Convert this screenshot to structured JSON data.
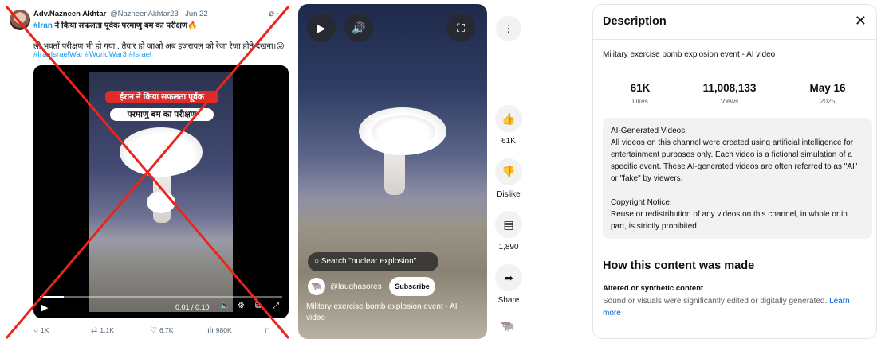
{
  "tweet": {
    "author_name": "Adv.Nazneen Akhtar",
    "author_handle": "@NazneenAkhtar23 · Jun 22",
    "headline_tag": "#Iran",
    "headline_text": " ने किया सफलता पूर्वक परमाणु बम का परीक्षण🔥",
    "body_text": "लो भक्तों परीक्षण भी हो गया.. तैयार हो जाओ अब इजरायल को रेजा रेजा होते देखना।😜",
    "hashtags": "#IranIsraelWar #WorldWar3 #Israel",
    "video_caption_1": "ईरान ने किया सफलता पूर्वक",
    "video_caption_2": "परमाणु बम का परीक्षण",
    "video_time": "0:01 / 0:10",
    "progress_fraction": 0.1,
    "replies": "1K",
    "reposts": "1.1K",
    "likes": "6.7K",
    "views": "980K"
  },
  "short": {
    "search_text": "Search \"nuclear explosion\"",
    "channel_name": "@laughasores",
    "subscribe_label": "Subscribe",
    "title": "Military exercise bomb explosion event - AI video"
  },
  "rail": {
    "likes_label": "61K",
    "dislike_label": "Dislike",
    "comments_label": "1,890",
    "share_label": "Share"
  },
  "description": {
    "header": "Description",
    "video_title": "Military exercise bomb explosion event - AI video",
    "stats": [
      {
        "value": "61K",
        "label": "Likes"
      },
      {
        "value": "11,008,133",
        "label": "Views"
      },
      {
        "value": "May 16",
        "label": "2025"
      }
    ],
    "box_heading": "AI-Generated Videos:",
    "box_text": "All videos on this channel were created using artificial intelligence for entertainment purposes only. Each video is a fictional simulation of a specific event. These AI-generated videos are often referred to as \"AI\" or \"fake\" by viewers.",
    "copyright_heading": "Copyright Notice:",
    "copyright_text": "Reuse or redistribution of any videos on this channel, in whole or in part, is strictly prohibited.",
    "how_heading": "How this content was made",
    "altered_heading": "Altered or synthetic content",
    "altered_text": "Sound or visuals were significantly edited or digitally generated. ",
    "learn_more": "Learn more"
  },
  "colors": {
    "overlay_red": "#e8261c",
    "twitter_blue": "#1d9bf0",
    "youtube_link": "#065fd4"
  }
}
